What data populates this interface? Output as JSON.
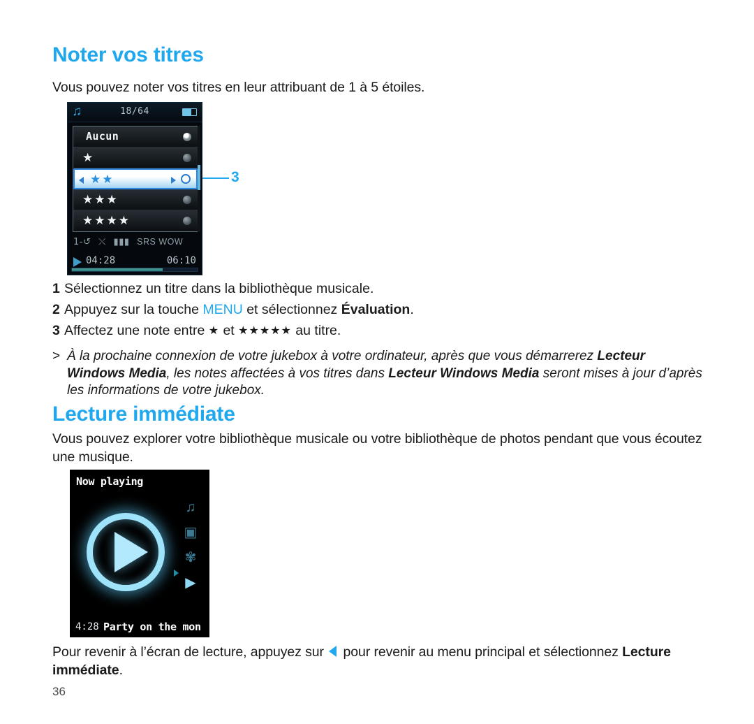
{
  "section_rate": {
    "heading": "Noter vos titres",
    "intro": "Vous pouvez noter vos titres en leur attribuant de 1 à 5 étoiles.",
    "steps": [
      {
        "num": "1",
        "text": "Sélectionnez un titre dans la bibliothèque musicale."
      },
      {
        "num": "2",
        "text_before": "Appuyez sur la touche ",
        "keyword": "MENU",
        "text_mid": " et sélectionnez ",
        "bold": "Évaluation",
        "text_after": "."
      },
      {
        "num": "3",
        "text_before": "Affectez une note entre ",
        "one_star": "★",
        "text_mid": " et ",
        "five_stars": "★★★★★",
        "text_after": " au titre."
      }
    ],
    "note": {
      "marker": ">",
      "part1": "À la prochaine connexion de votre jukebox à votre ordinateur, après que vous démarrerez ",
      "bold1": "Lecteur Windows Media",
      "part2": ", les notes affectées à vos titres dans ",
      "bold2": "Lecteur Windows Media",
      "part3": " seront mises à jour d’après les informations de votre jukebox."
    },
    "callout": "3"
  },
  "device_rating_screen": {
    "status": {
      "music_icon": "music-note-icon",
      "track_count": "18/64",
      "battery_icon": "battery-icon"
    },
    "list": [
      {
        "label": "Aucun",
        "stars": "",
        "selected": false,
        "checked": true
      },
      {
        "label": "",
        "stars": "★",
        "selected": false,
        "checked": false
      },
      {
        "label": "",
        "stars": "★★",
        "selected": true,
        "checked": false
      },
      {
        "label": "",
        "stars": "★★★",
        "selected": false,
        "checked": false
      },
      {
        "label": "",
        "stars": "★★★★",
        "selected": false,
        "checked": false
      }
    ],
    "mode_icons": {
      "repeat_one": "1-↺",
      "shuffle": "⤬",
      "equalizer": "▮▮▮",
      "srs_wow": "SRS WOW"
    },
    "playback": {
      "play_icon": "play-icon",
      "elapsed": "04:28",
      "total": "06:10",
      "progress_percent": 72
    }
  },
  "section_nowplaying": {
    "heading": "Lecture immédiate",
    "intro": "Vous pouvez explorer votre bibliothèque musicale ou votre bibliothèque de photos pendant que vous écoutez une musique.",
    "outro": {
      "part1": "Pour revenir à l’écran de lecture, appuyez sur ",
      "arrow": "left-arrow-icon",
      "part2": " pour revenir au menu principal et sélectionnez ",
      "bold": "Lecture immédiate",
      "part3": "."
    }
  },
  "device_nowplaying_screen": {
    "title": "Now playing",
    "side_icons": [
      {
        "name": "music-note-icon",
        "glyph": "♫",
        "active": false
      },
      {
        "name": "camera-icon",
        "glyph": "▣",
        "active": false
      },
      {
        "name": "gear-icon",
        "glyph": "✾",
        "active": false
      },
      {
        "name": "now-playing-icon",
        "glyph": "▶",
        "active": true
      }
    ],
    "center_icon": "play-circle-icon",
    "elapsed": "4:28",
    "track_title": "Party on the mon"
  },
  "footer": {
    "page_number": "36"
  }
}
